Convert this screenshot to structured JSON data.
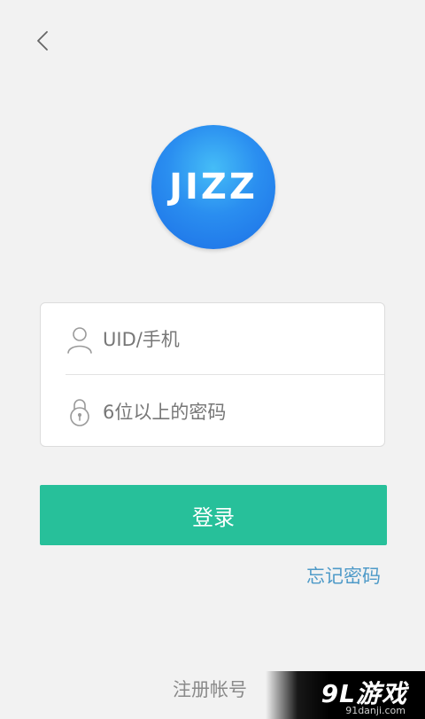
{
  "nav": {
    "back_icon": "chevron-left-icon"
  },
  "logo": {
    "text": "JIZZ"
  },
  "form": {
    "uid": {
      "placeholder": "UID/手机",
      "icon": "user-icon"
    },
    "password": {
      "placeholder": "6位以上的密码",
      "icon": "lock-icon"
    }
  },
  "actions": {
    "login_label": "登录",
    "forgot_label": "忘记密码",
    "register_label": "注册帐号"
  },
  "watermark": {
    "main": "9L游戏",
    "sub": "91danji.com"
  },
  "colors": {
    "background": "#f2f2f2",
    "primary": "#27c09a",
    "link": "#4e9ac8",
    "logo_blue": "#2a8ef0"
  }
}
